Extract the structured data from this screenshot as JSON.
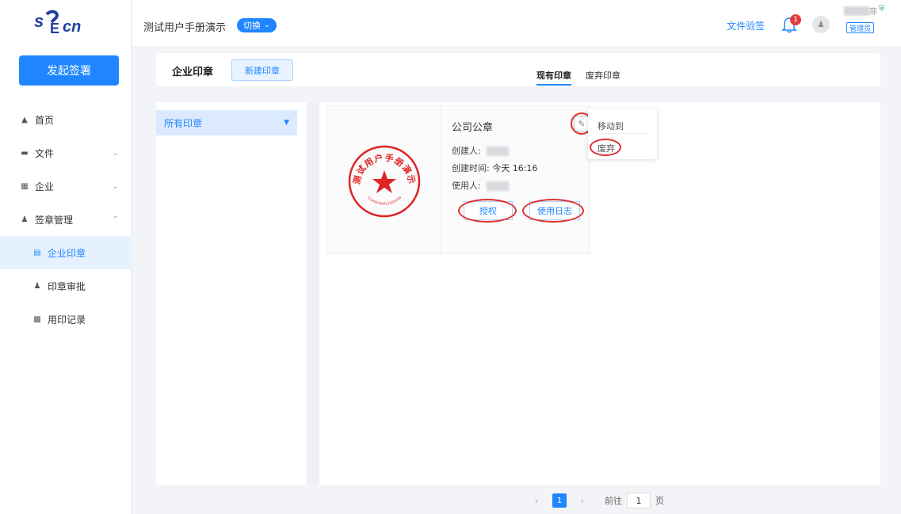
{
  "brand": {
    "logo_text": "SECA"
  },
  "sidebar": {
    "start_button": "发起签署",
    "items": [
      {
        "label": "首页",
        "icon": "home-icon"
      },
      {
        "label": "文件",
        "icon": "folder-icon"
      },
      {
        "label": "企业",
        "icon": "building-icon"
      },
      {
        "label": "签章管理",
        "icon": "user-icon"
      }
    ],
    "sub_items": [
      {
        "label": "企业印章",
        "icon": "document-icon",
        "active": true
      },
      {
        "label": "印章审批",
        "icon": "approve-icon"
      },
      {
        "label": "用印记录",
        "icon": "record-icon"
      }
    ]
  },
  "topbar": {
    "org_name": "测试用户手册演示",
    "switch_label": "切换",
    "verify_link": "文件验签",
    "notification_count": "1",
    "user_name_char": "菲",
    "role": "管理员"
  },
  "header": {
    "title": "企业印章",
    "new_button": "新建印章",
    "tabs": [
      "现有印章",
      "废弃印章"
    ],
    "active_tab": "现有印章"
  },
  "filter": {
    "selected": "所有印章"
  },
  "seal": {
    "name": "公司公章",
    "creator_label": "创建人:",
    "created_time_label": "创建时间:",
    "created_time_value": "今天 16:16",
    "user_label": "使用人:",
    "authorize_button": "授权",
    "log_button": "使用日志",
    "stamp_text": "测试用户手册演示",
    "stamp_number": "1234567890123456789"
  },
  "dropdown": {
    "move_to": "移动到",
    "discard": "废弃"
  },
  "pagination": {
    "current_page": "1",
    "goto_label": "前往",
    "goto_value": "1",
    "page_suffix": "页"
  },
  "colors": {
    "accent": "#1f86ff",
    "annotation": "#e03030",
    "stamp": "#e02424"
  }
}
